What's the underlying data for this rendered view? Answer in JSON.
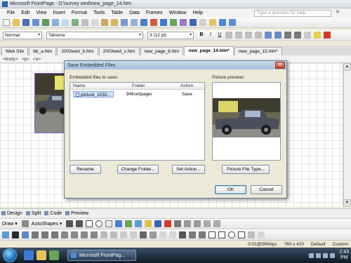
{
  "window": {
    "title": "Microsoft FrontPage - D:\\survey wed\\new_page_14.htm",
    "help_placeholder": "Type a question for help",
    "close_glyph": "✕"
  },
  "menu": [
    "File",
    "Edit",
    "View",
    "Insert",
    "Format",
    "Tools",
    "Table",
    "Data",
    "Frames",
    "Window",
    "Help"
  ],
  "format_toolbar": {
    "style": "Normal",
    "font": "Tahoma",
    "size": "3 (12 pt)",
    "bold": "B",
    "italic": "I",
    "underline": "U"
  },
  "tabs": [
    "Web Site",
    "bb_a.htm",
    "2003wed_b.htm",
    "2003wed_c.htm",
    "new_page_6.htm",
    "new_page_14.htm*",
    "new_page_15.htm*"
  ],
  "active_tab_index": 5,
  "quick_tags": [
    "<body>",
    "<p>",
    "<a>"
  ],
  "view_tabs": [
    "Design",
    "Split",
    "Code",
    "Preview"
  ],
  "draw_toolbar": {
    "draw_label": "Draw ▾",
    "autoshapes_label": "AutoShapes ▾"
  },
  "status": {
    "download": "0:01@56Kbps",
    "dimensions": "760 x 420",
    "style": "Default",
    "mode": "Custom"
  },
  "taskbar": {
    "app_button": "Microsoft FrontPag...",
    "time": "2:43",
    "period": "PM"
  },
  "dialog": {
    "title": "Save Embedded Files",
    "embedded_label": "Embedded files to save:",
    "preview_label": "Picture preview:",
    "columns": [
      "Name",
      "Folder",
      "Action"
    ],
    "rows": [
      {
        "name": "picture_1032...",
        "folder": "94frontpage/",
        "action": "Save"
      }
    ],
    "buttons": {
      "rename": "Rename",
      "change_folder": "Change Folder...",
      "set_action": "Set Action...",
      "picture_file_type": "Picture File Type...",
      "ok": "OK",
      "cancel": "Cancel"
    },
    "close_glyph": "✕"
  },
  "colors": {
    "dialog_bg": "#ece9d8",
    "selection": "#cfe3fa",
    "taskbar": "#1b2735",
    "accent": "#2a6fc9"
  }
}
